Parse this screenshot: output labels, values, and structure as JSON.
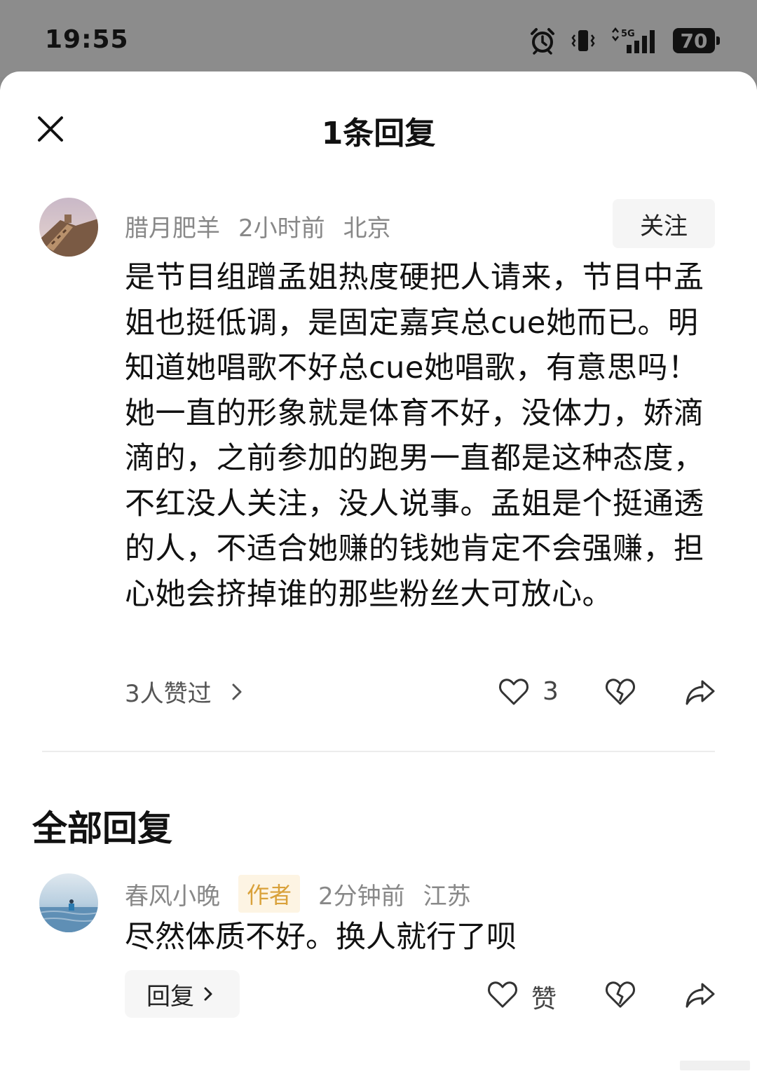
{
  "status_bar": {
    "time": "19:55",
    "network": "5G",
    "battery": "70"
  },
  "header": {
    "title": "1条回复"
  },
  "comment": {
    "username": "腊月肥羊",
    "time": "2小时前",
    "location": "北京",
    "follow_label": "关注",
    "text": "是节目组蹭孟姐热度硬把人请来，节目中孟姐也挺低调，是固定嘉宾总cue她而已。明知道她唱歌不好总cue她唱歌，有意思吗！她一直的形象就是体育不好，没体力，娇滴滴的，之前参加的跑男一直都是这种态度，不红没人关注，没人说事。孟姐是个挺通透的人，不适合她赚的钱她肯定不会强赚，担心她会挤掉谁的那些粉丝大可放心。",
    "likers_text": "3人赞过",
    "like_count": "3"
  },
  "replies_section": {
    "title": "全部回复"
  },
  "reply": {
    "username": "春风小晚",
    "badge": "作者",
    "time": "2分钟前",
    "location": "江苏",
    "text": "尽然体质不好。换人就行了呗",
    "reply_button_label": "回复",
    "like_label": "赞"
  },
  "colors": {
    "sheet_background": "#ffffff",
    "overlay": "#8c8c8c",
    "author_badge_text": "#d9a13a",
    "author_badge_bg": "#fdf4e3"
  },
  "icons": [
    "alarm-icon",
    "vibrate-icon",
    "signal-icon",
    "battery-icon",
    "close-icon",
    "chevron-right-icon",
    "heart-icon",
    "broken-heart-icon",
    "share-icon"
  ]
}
